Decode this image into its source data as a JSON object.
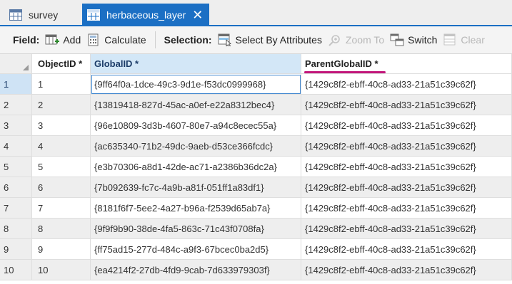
{
  "tabs": [
    {
      "label": "survey",
      "icon": "table-icon",
      "active": false
    },
    {
      "label": "herbaceous_layer",
      "icon": "table-icon",
      "active": true,
      "close": "✕"
    }
  ],
  "toolbar": {
    "field_label": "Field:",
    "add_label": "Add",
    "calculate_label": "Calculate",
    "selection_label": "Selection:",
    "select_by_attributes_label": "Select By Attributes",
    "zoom_to_label": "Zoom To",
    "switch_label": "Switch",
    "clear_label": "Clear"
  },
  "table": {
    "columns": [
      "ObjectID *",
      "GlobalID *",
      "ParentGlobalID *"
    ],
    "rows": [
      {
        "num": "1",
        "objectid": "1",
        "globalid": "{9ff64f0a-1dce-49c3-9d1e-f53dc0999968}",
        "parentglobalid": "{1429c8f2-ebff-40c8-ad33-21a51c39c62f}"
      },
      {
        "num": "2",
        "objectid": "2",
        "globalid": "{13819418-827d-45ac-a0ef-e22a8312bec4}",
        "parentglobalid": "{1429c8f2-ebff-40c8-ad33-21a51c39c62f}"
      },
      {
        "num": "3",
        "objectid": "3",
        "globalid": "{96e10809-3d3b-4607-80e7-a94c8ecec55a}",
        "parentglobalid": "{1429c8f2-ebff-40c8-ad33-21a51c39c62f}"
      },
      {
        "num": "4",
        "objectid": "4",
        "globalid": "{ac635340-71b2-49dc-9aeb-d53ce366fcdc}",
        "parentglobalid": "{1429c8f2-ebff-40c8-ad33-21a51c39c62f}"
      },
      {
        "num": "5",
        "objectid": "5",
        "globalid": "{e3b70306-a8d1-42de-ac71-a2386b36dc2a}",
        "parentglobalid": "{1429c8f2-ebff-40c8-ad33-21a51c39c62f}"
      },
      {
        "num": "6",
        "objectid": "6",
        "globalid": "{7b092639-fc7c-4a9b-a81f-051ff1a83df1}",
        "parentglobalid": "{1429c8f2-ebff-40c8-ad33-21a51c39c62f}"
      },
      {
        "num": "7",
        "objectid": "7",
        "globalid": "{8181f6f7-5ee2-4a27-b96a-f2539d65ab7a}",
        "parentglobalid": "{1429c8f2-ebff-40c8-ad33-21a51c39c62f}"
      },
      {
        "num": "8",
        "objectid": "8",
        "globalid": "{9f9f9b90-38de-4fa5-863c-71c43f0708fa}",
        "parentglobalid": "{1429c8f2-ebff-40c8-ad33-21a51c39c62f}"
      },
      {
        "num": "9",
        "objectid": "9",
        "globalid": "{ff75ad15-277d-484c-a9f3-67bcec0ba2d5}",
        "parentglobalid": "{1429c8f2-ebff-40c8-ad33-21a51c39c62f}"
      },
      {
        "num": "10",
        "objectid": "10",
        "globalid": "{ea4214f2-27db-4fd9-9cab-7d633979303f}",
        "parentglobalid": "{1429c8f2-ebff-40c8-ad33-21a51c39c62f}"
      }
    ]
  },
  "colors": {
    "accent": "#1b6fc4",
    "annotation": "#c2167a",
    "selected_header": "#d3e7f7"
  }
}
